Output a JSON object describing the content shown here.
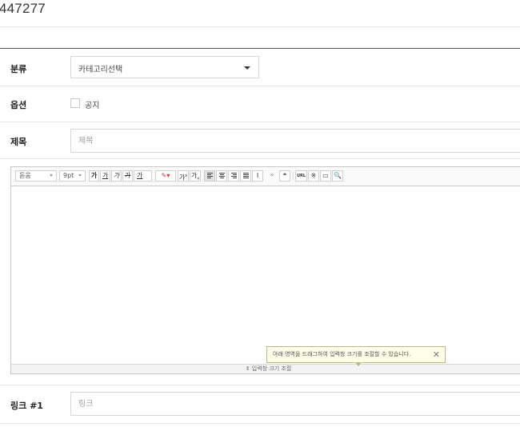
{
  "page": {
    "title": "447277"
  },
  "form": {
    "category": {
      "label": "분류",
      "value": "카테고리선택"
    },
    "options": {
      "label": "옵션",
      "notice_label": "공지"
    },
    "subject": {
      "label": "제목",
      "placeholder": "제목"
    },
    "link1": {
      "label": "링크 #1",
      "placeholder": "링크"
    }
  },
  "editor": {
    "toolbar": {
      "font_family": "돋움",
      "font_size": "9pt",
      "bold": "가",
      "underline": "가",
      "italic": "가",
      "strike": "가",
      "text_color": "가",
      "superscript": "가",
      "subscript": "가",
      "more": "»",
      "quote": "❝",
      "url": "URL",
      "special_char": "※",
      "table": "▭",
      "find": "🔍"
    },
    "tooltip": {
      "text": "아래 영역을 드래그하여 입력창 크기를 조절할 수 있습니다.",
      "close": "✕"
    },
    "resize_label": "⇕ 입력창 크기 조절"
  }
}
